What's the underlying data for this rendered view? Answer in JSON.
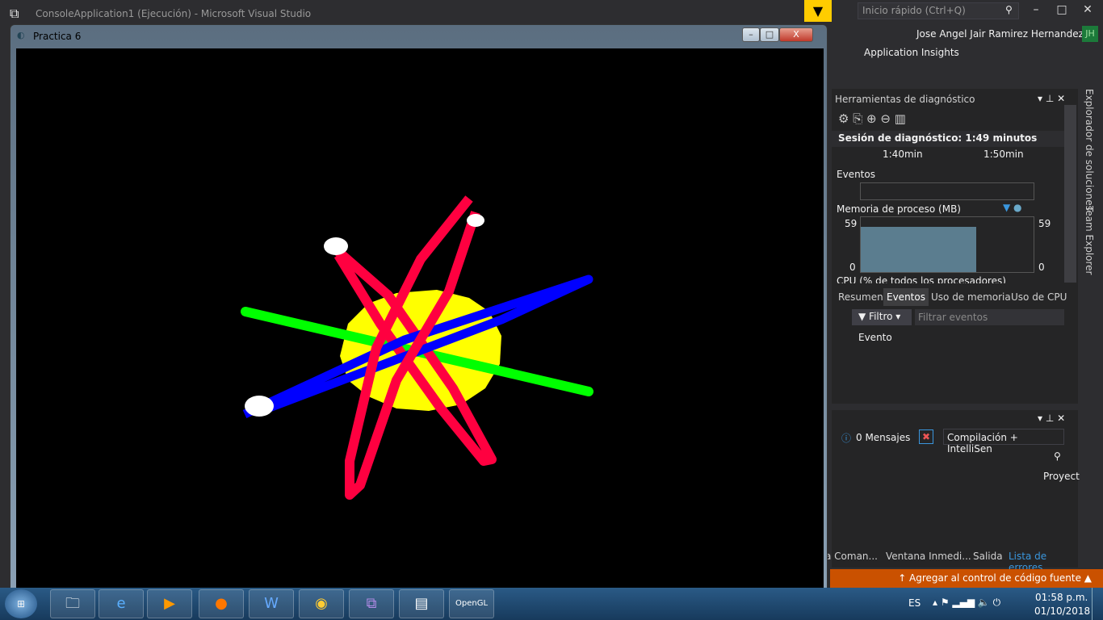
{
  "vs": {
    "title": "ConsoleApplication1 (Ejecución) - Microsoft Visual Studio",
    "quick_launch": "Inicio rápido (Ctrl+Q)",
    "user": "Jose Angel Jair Ramirez Hernandez",
    "avatar": "JH",
    "insights": "Application Insights"
  },
  "window": {
    "title": "Practica 6",
    "min": "–",
    "max": "□",
    "close": "X"
  },
  "diag": {
    "title": "Herramientas de diagnóstico",
    "session": "Sesión de diagnóstico: 1:49 minutos",
    "ticks": [
      "1:40min",
      "1:50min"
    ],
    "events": "Eventos",
    "memory": "Memoria de proceso (MB)",
    "mem_max": "59",
    "mem_min": "0",
    "memory_fill_fraction": 0.67,
    "cpu": "CPU (% de todos los procesadores)",
    "tabs": [
      "Resumen",
      "Eventos",
      "Uso de memoria",
      "Uso de CPU"
    ],
    "filter": "Filtro",
    "filter_placeholder": "Filtrar eventos",
    "col": "Evento"
  },
  "side_tabs": [
    "Explorador de soluciones",
    "Team Explorer"
  ],
  "errors": {
    "messages": "0 Mensajes",
    "scope": "Compilación + IntelliSen",
    "col": "Proyect",
    "tabs": [
      "a Coman...",
      "Ventana Inmedi...",
      "Salida",
      "Lista de errores"
    ]
  },
  "status": {
    "source_control": "↑  Agregar al control de código fuente ▲"
  },
  "taskbar": {
    "lang": "ES",
    "time": "01:58 p.m.",
    "date": "01/10/2018",
    "apps": [
      "explorer",
      "ie",
      "media",
      "firefox",
      "word",
      "chrome",
      "visual-studio",
      "console",
      "opengl"
    ]
  },
  "colors": {
    "sun": "#ffff00",
    "orbit_green": "#00ff00",
    "orbit_blue": "#0000ff",
    "orbit_red": "#ff0040",
    "accent": "#ca5100"
  }
}
